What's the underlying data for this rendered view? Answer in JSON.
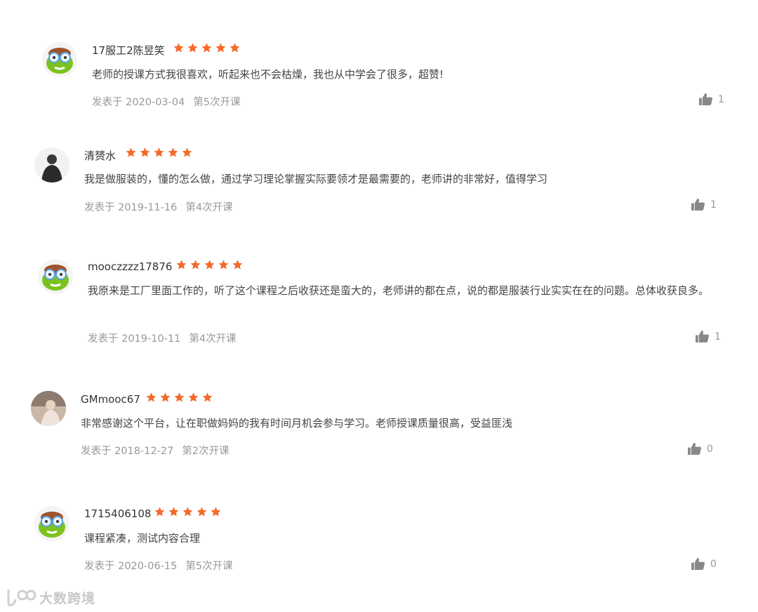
{
  "reviews": [
    {
      "user": "17服工2陈昱笑",
      "avatar": "green-cartoon-avatar",
      "rating": 5,
      "content": "老师的授课方式我很喜欢，听起来也不会枯燥，我也从中学会了很多，超赞!",
      "date": "发表于 2020-03-04",
      "session": "第5次开课",
      "likes": "1"
    },
    {
      "user": "清赟水",
      "avatar": "person-photo-avatar",
      "rating": 5,
      "content": "我是做服装的，懂的怎么做，通过学习理论掌握实际要领才是最需要的，老师讲的非常好，值得学习",
      "date": "发表于 2019-11-16",
      "session": "第4次开课",
      "likes": "1"
    },
    {
      "user": "mooczzzz17876",
      "avatar": "green-cartoon-avatar",
      "rating": 5,
      "content": "我原来是工厂里面工作的，听了这个课程之后收获还是蛮大的，老师讲的都在点，说的都是服装行业实实在在的问题。总体收获良多。",
      "date": "发表于 2019-10-11",
      "session": "第4次开课",
      "likes": "1"
    },
    {
      "user": "GMmooc67",
      "avatar": "photo-avatar",
      "rating": 5,
      "content": "非常感谢这个平台，让在职做妈妈的我有时间月机会参与学习。老师授课质量很高，受益匪浅",
      "date": "发表于 2018-12-27",
      "session": "第2次开课",
      "likes": "0"
    },
    {
      "user": "1715406108",
      "avatar": "green-cartoon-avatar",
      "rating": 5,
      "content": "课程紧凑，测试内容合理",
      "date": "发表于 2020-06-15",
      "session": "第5次开课",
      "likes": "0"
    }
  ],
  "star_color": "#f46a2b",
  "watermark": "大数跨境"
}
